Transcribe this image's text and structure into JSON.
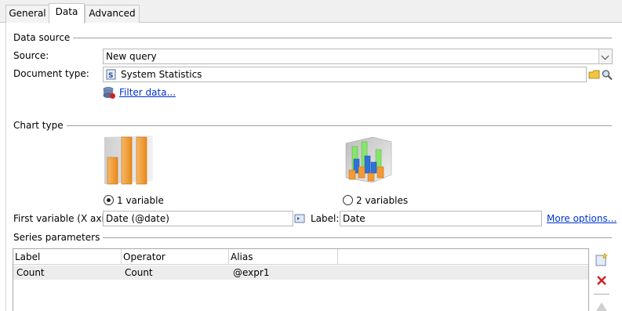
{
  "tabs": [
    {
      "label": "General"
    },
    {
      "label": "Data"
    },
    {
      "label": "Advanced"
    }
  ],
  "data_source": {
    "title": "Data source",
    "source_label": "Source:",
    "source_value": "New query",
    "doctype_label": "Document type:",
    "doctype_value": "System Statistics",
    "filter_link": "Filter data..."
  },
  "chart_type": {
    "title": "Chart type",
    "option1_label": "1 variable",
    "option2_label": "2 variables",
    "selected": "1 variable",
    "first_var_label": "First variable (X axis):",
    "first_var_value": "Date (@date)",
    "label_label": "Label:",
    "label_value": "Date",
    "more_options": "More options..."
  },
  "series": {
    "title": "Series parameters",
    "columns": [
      "Label",
      "Operator",
      "Alias"
    ],
    "rows": [
      [
        "Count",
        "Count",
        "@expr1"
      ]
    ]
  },
  "colors": {
    "accent_link": "#0033cc",
    "bar_orange": "#f5a142",
    "bar_green": "#7fe05a",
    "bar_blue": "#2e6fd8"
  }
}
